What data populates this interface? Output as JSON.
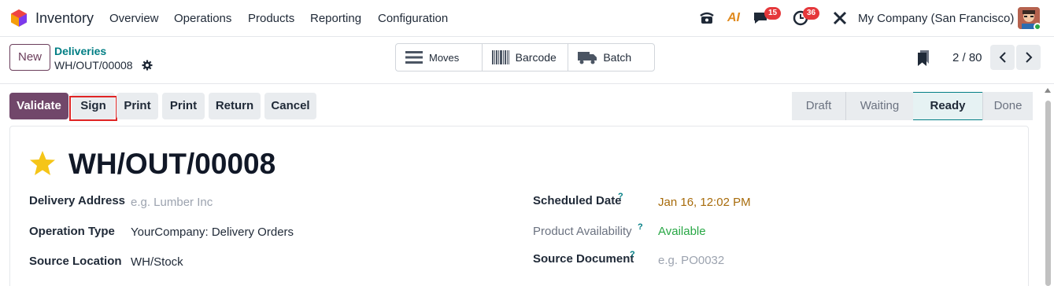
{
  "navbar": {
    "app_name": "Inventory",
    "menu": [
      "Overview",
      "Operations",
      "Products",
      "Reporting",
      "Configuration"
    ],
    "ai_label": "AI",
    "messages_count": "15",
    "activities_count": "36",
    "company": "My Company (San Francisco)",
    "icons": [
      "phone-icon",
      "ai-icon",
      "chat-icon",
      "clock-icon",
      "tools-icon"
    ]
  },
  "control_panel": {
    "new_label": "New",
    "breadcrumb_parent": "Deliveries",
    "breadcrumb_current": "WH/OUT/00008",
    "smart_buttons": [
      {
        "label": "Moves",
        "icon": "list-icon"
      },
      {
        "label": "Barcode",
        "icon": "barcode-icon"
      },
      {
        "label": "Batch",
        "icon": "truck-icon"
      }
    ],
    "pager": "2 / 80"
  },
  "actions": {
    "validate": "Validate",
    "sign": "Sign",
    "print1": "Print",
    "print2": "Print",
    "return": "Return",
    "cancel": "Cancel"
  },
  "status": {
    "steps": [
      "Draft",
      "Waiting",
      "Ready",
      "Done"
    ],
    "active": "Ready"
  },
  "form": {
    "title": "WH/OUT/00008",
    "delivery_address_label": "Delivery Address",
    "delivery_address_placeholder": "e.g. Lumber Inc",
    "operation_type_label": "Operation Type",
    "operation_type_value": "YourCompany: Delivery Orders",
    "source_location_label": "Source Location",
    "source_location_value": "WH/Stock",
    "scheduled_date_label": "Scheduled Date",
    "scheduled_date_value": "Jan 16, 12:02 PM",
    "product_availability_label": "Product Availability",
    "product_availability_value": "Available",
    "source_document_label": "Source Document",
    "source_document_placeholder": "e.g. PO0032",
    "help_mark": "?"
  },
  "colors": {
    "brand": "#71476a",
    "teal": "#017e84",
    "badge": "#e5383b",
    "warning": "#a76b0b",
    "success": "#28a745",
    "highlight": "#e02424"
  }
}
